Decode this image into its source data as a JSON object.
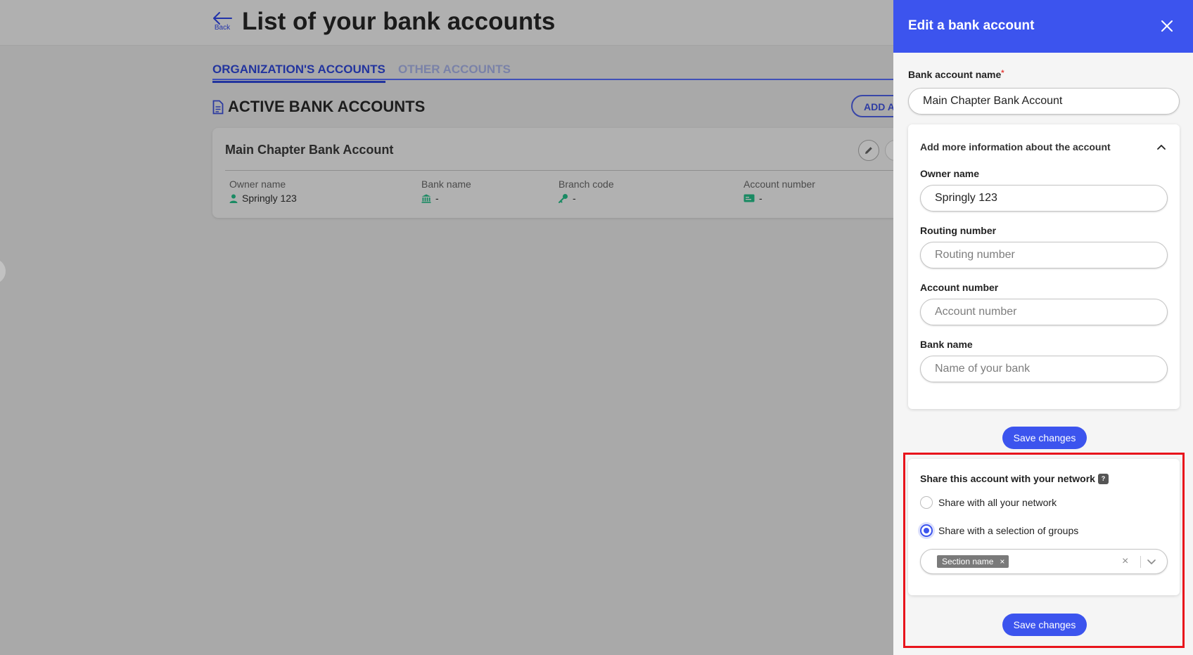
{
  "header": {
    "back_label": "Back",
    "title": "List of your bank accounts"
  },
  "tabs": [
    {
      "label": "ORGANIZATION'S ACCOUNTS",
      "active": true
    },
    {
      "label": "OTHER ACCOUNTS",
      "active": false
    }
  ],
  "section": {
    "title": "ACTIVE BANK ACCOUNTS",
    "add_button_label": "ADD A"
  },
  "account_card": {
    "name": "Main Chapter Bank Account",
    "columns": [
      {
        "label": "Owner name",
        "value": "Springly 123",
        "icon": "person-icon"
      },
      {
        "label": "Bank name",
        "value": "-",
        "icon": "bank-icon"
      },
      {
        "label": "Branch code",
        "value": "-",
        "icon": "key-icon"
      },
      {
        "label": "Account number",
        "value": "-",
        "icon": "card-icon"
      }
    ]
  },
  "drawer": {
    "title": "Edit a bank account",
    "account_name_label": "Bank account name",
    "required_mark": "*",
    "account_name_value": "Main Chapter Bank Account",
    "more_info": {
      "heading": "Add more information about the account",
      "owner_label": "Owner name",
      "owner_value": "Springly 123",
      "routing_label": "Routing number",
      "routing_placeholder": "Routing number",
      "account_label": "Account number",
      "account_placeholder": "Account number",
      "bank_label": "Bank name",
      "bank_placeholder": "Name of your bank"
    },
    "save_label": "Save changes",
    "share": {
      "title": "Share this account with your network",
      "help_icon": "?",
      "option_all": "Share with all your network",
      "option_groups": "Share with a selection of groups",
      "selected_option": "groups",
      "selected_groups": [
        "Section name"
      ],
      "chip_remove": "×"
    },
    "save_label_2": "Save changes"
  },
  "colors": {
    "accent": "#3c54ee",
    "highlight": "#e8141c",
    "icon_green": "#1a8a63"
  }
}
